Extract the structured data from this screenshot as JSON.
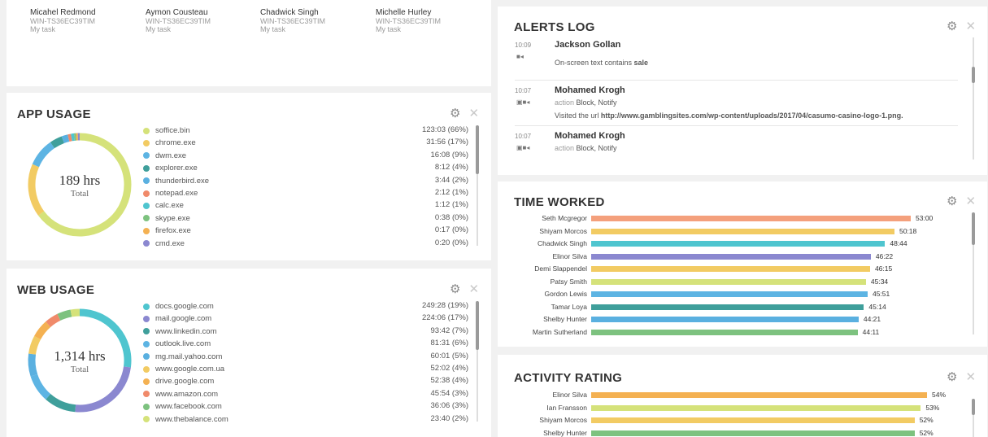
{
  "users": [
    {
      "name": "Micahel Redmond",
      "host": "WIN-TS36EC39TIM",
      "task": "My task"
    },
    {
      "name": "Aymon Cousteau",
      "host": "WIN-TS36EC39TIM",
      "task": "My task"
    },
    {
      "name": "Chadwick Singh",
      "host": "WIN-TS36EC39TIM",
      "task": "My task"
    },
    {
      "name": "Michelle Hurley",
      "host": "WIN-TS36EC39TIM",
      "task": "My task"
    }
  ],
  "app_usage": {
    "title": "APP USAGE",
    "total_value": "189 hrs",
    "total_label": "Total",
    "items": [
      {
        "label": "soffice.bin",
        "value": "123:03 (66%)",
        "color": "#d5e27a",
        "pct": 66
      },
      {
        "label": "chrome.exe",
        "value": "31:56 (17%)",
        "color": "#f2cb63",
        "pct": 17
      },
      {
        "label": "dwm.exe",
        "value": "16:08 (9%)",
        "color": "#5db4e3",
        "pct": 9
      },
      {
        "label": "explorer.exe",
        "value": "8:12 (4%)",
        "color": "#3f9f9b",
        "pct": 4
      },
      {
        "label": "thunderbird.exe",
        "value": "3:44 (2%)",
        "color": "#5ab0e0",
        "pct": 2
      },
      {
        "label": "notepad.exe",
        "value": "2:12 (1%)",
        "color": "#f08a6a",
        "pct": 1
      },
      {
        "label": "calc.exe",
        "value": "1:12 (1%)",
        "color": "#4fc5cf",
        "pct": 1
      },
      {
        "label": "skype.exe",
        "value": "0:38 (0%)",
        "color": "#7dc27f",
        "pct": 0
      },
      {
        "label": "firefox.exe",
        "value": "0:17 (0%)",
        "color": "#f4b152",
        "pct": 0
      },
      {
        "label": "cmd.exe",
        "value": "0:20 (0%)",
        "color": "#8b88d0",
        "pct": 0
      }
    ]
  },
  "web_usage": {
    "title": "WEB USAGE",
    "total_value": "1,314 hrs",
    "total_label": "Total",
    "items": [
      {
        "label": "docs.google.com",
        "value": "249:28 (19%)",
        "color": "#4fc5cf",
        "pct": 19
      },
      {
        "label": "mail.google.com",
        "value": "224:06 (17%)",
        "color": "#8b88d0",
        "pct": 17
      },
      {
        "label": "www.linkedin.com",
        "value": "93:42 (7%)",
        "color": "#3f9f9b",
        "pct": 7
      },
      {
        "label": "outlook.live.com",
        "value": "81:31 (6%)",
        "color": "#5db4e3",
        "pct": 6
      },
      {
        "label": "mg.mail.yahoo.com",
        "value": "60:01 (5%)",
        "color": "#5ab0e0",
        "pct": 5
      },
      {
        "label": "www.google.com.ua",
        "value": "52:02 (4%)",
        "color": "#f2cb63",
        "pct": 4
      },
      {
        "label": "drive.google.com",
        "value": "52:38 (4%)",
        "color": "#f4b152",
        "pct": 4
      },
      {
        "label": "www.amazon.com",
        "value": "45:54 (3%)",
        "color": "#f08a6a",
        "pct": 3
      },
      {
        "label": "www.facebook.com",
        "value": "36:06 (3%)",
        "color": "#7dc27f",
        "pct": 3
      },
      {
        "label": "www.thebalance.com",
        "value": "23:40 (2%)",
        "color": "#d5e27a",
        "pct": 2
      }
    ]
  },
  "alerts": {
    "title": "ALERTS LOG",
    "entries": [
      {
        "time": "10:09",
        "name": "Jackson Gollan",
        "action_label": "",
        "action": "",
        "text_prefix": "On-screen text contains ",
        "text_bold": "sale"
      },
      {
        "time": "10:07",
        "name": "Mohamed Krogh",
        "action_label": "action",
        "action": "Block, Notify",
        "text_prefix": "Visited the url ",
        "text_bold": "http://www.gamblingsites.com/wp-content/uploads/2017/04/casumo-casino-logo-1.png."
      },
      {
        "time": "10:07",
        "name": "Mohamed Krogh",
        "action_label": "action",
        "action": "Block, Notify",
        "text_prefix": "",
        "text_bold": ""
      }
    ]
  },
  "time_worked": {
    "title": "TIME WORKED",
    "max_minutes": 3180,
    "rows": [
      {
        "name": "Seth Mcgregor",
        "value": "53:00",
        "minutes": 3180,
        "color": "#f4a07c"
      },
      {
        "name": "Shiyam Morcos",
        "value": "50:18",
        "minutes": 3018,
        "color": "#f2cb63"
      },
      {
        "name": "Chadwick Singh",
        "value": "48:44",
        "minutes": 2924,
        "color": "#4fc5cf"
      },
      {
        "name": "Elinor Silva",
        "value": "46:22",
        "minutes": 2782,
        "color": "#8b88d0"
      },
      {
        "name": "Demi Slappendel",
        "value": "46:15",
        "minutes": 2775,
        "color": "#f2cb63"
      },
      {
        "name": "Patsy Smith",
        "value": "45:34",
        "minutes": 2734,
        "color": "#d5e27a"
      },
      {
        "name": "Gordon Lewis",
        "value": "45:51",
        "minutes": 2751,
        "color": "#5db4e3"
      },
      {
        "name": "Tamar Loya",
        "value": "45:14",
        "minutes": 2714,
        "color": "#3f9f9b"
      },
      {
        "name": "Shelby Hunter",
        "value": "44:21",
        "minutes": 2661,
        "color": "#5ab0e0"
      },
      {
        "name": "Martin Sutherland",
        "value": "44:11",
        "minutes": 2651,
        "color": "#7dc27f"
      }
    ]
  },
  "activity_rating": {
    "title": "ACTIVITY RATING",
    "max_pct": 54,
    "rows": [
      {
        "name": "Elinor Silva",
        "value": "54%",
        "pct": 54,
        "color": "#f4b152"
      },
      {
        "name": "Ian Fransson",
        "value": "53%",
        "pct": 53,
        "color": "#d5e27a"
      },
      {
        "name": "Shiyam Morcos",
        "value": "52%",
        "pct": 52,
        "color": "#f2cb63"
      },
      {
        "name": "Shelby Hunter",
        "value": "52%",
        "pct": 52,
        "color": "#7dc27f"
      }
    ]
  }
}
